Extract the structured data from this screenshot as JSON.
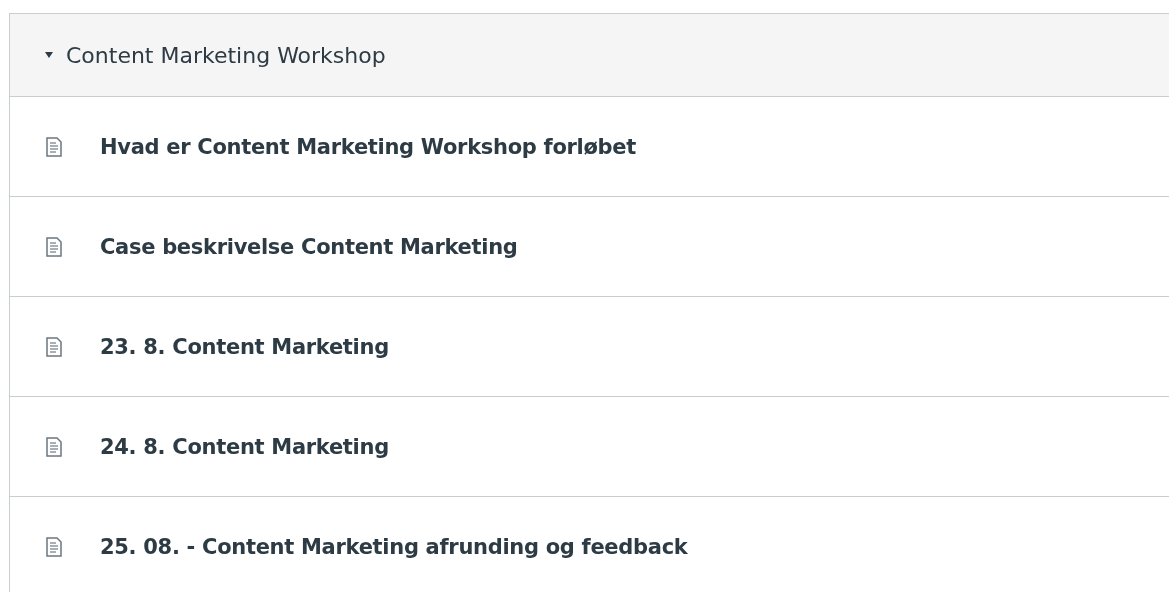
{
  "module": {
    "title": "Content Marketing Workshop",
    "expanded": true,
    "items": [
      {
        "title": "Hvad er Content Marketing Workshop forløbet",
        "kind": "page"
      },
      {
        "title": "Case beskrivelse Content Marketing",
        "kind": "page"
      },
      {
        "title": "23. 8. Content Marketing",
        "kind": "page"
      },
      {
        "title": "24. 8. Content Marketing",
        "kind": "page"
      },
      {
        "title": "25. 08. - Content Marketing afrunding og feedback",
        "kind": "page"
      }
    ]
  }
}
